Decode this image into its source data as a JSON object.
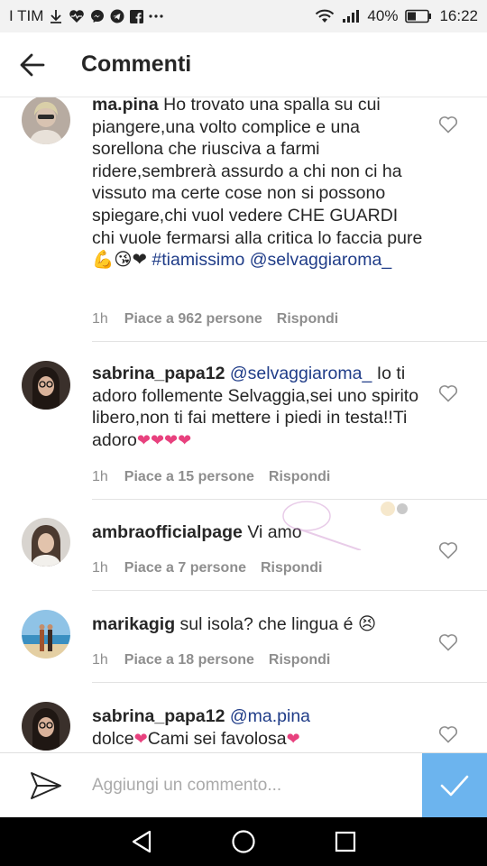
{
  "statusbar": {
    "carrier": "I TIM",
    "battery": "40%",
    "time": "16:22",
    "icons_left": [
      "download-icon",
      "heart-pulse-icon",
      "messenger-icon",
      "telegram-icon",
      "facebook-icon",
      "more-dots-icon"
    ],
    "icons_right": [
      "wifi-icon",
      "signal-icon",
      "battery-icon"
    ]
  },
  "header": {
    "title": "Commenti",
    "back_icon": "arrow-back-icon"
  },
  "comments": [
    {
      "username": "ma.pina",
      "text": "Ho trovato una spalla su cui piangere,una volto complice e una sorellona che riusciva a farmi ridere,sembrerà assurdo a chi non ci ha vissuto ma certe cose non si possono spiegare,chi vuol vedere CHE GUARDI chi vuole fermarsi alla critica lo faccia pure",
      "emoji": "💪😘❤",
      "hashtag": "#tiamissimo",
      "mention": "@selvaggiaroma_",
      "time": "1h",
      "likes": "Piace a 962 persone",
      "reply": "Rispondi"
    },
    {
      "username": "sabrina_papa12",
      "mention": "@selvaggiaroma_",
      "text": "Io ti adoro follemente Selvaggia,sei uno spirito libero,non ti fai mettere i piedi in testa!!Ti adoro",
      "emoji": "❤❤❤❤",
      "time": "1h",
      "likes": "Piace a 15 persone",
      "reply": "Rispondi"
    },
    {
      "username": "ambraofficialpage",
      "text": "Vi amo",
      "time": "1h",
      "likes": "Piace a 7 persone",
      "reply": "Rispondi"
    },
    {
      "username": "marikagig",
      "text": "sul isola? che lingua é",
      "emoji": "😣",
      "time": "1h",
      "likes": "Piace a 18 persone",
      "reply": "Rispondi"
    },
    {
      "username": "sabrina_papa12",
      "mention": "@ma.pina",
      "text_a": "dolce",
      "text_b": "Cami sei favolosa",
      "emoji": "❤"
    }
  ],
  "input": {
    "placeholder": "Aggiungi un commento..."
  },
  "colors": {
    "link": "#1f3c88",
    "meta": "#8e8e8e",
    "post_button": "#6cb4ee",
    "heart": "#e8417e"
  }
}
